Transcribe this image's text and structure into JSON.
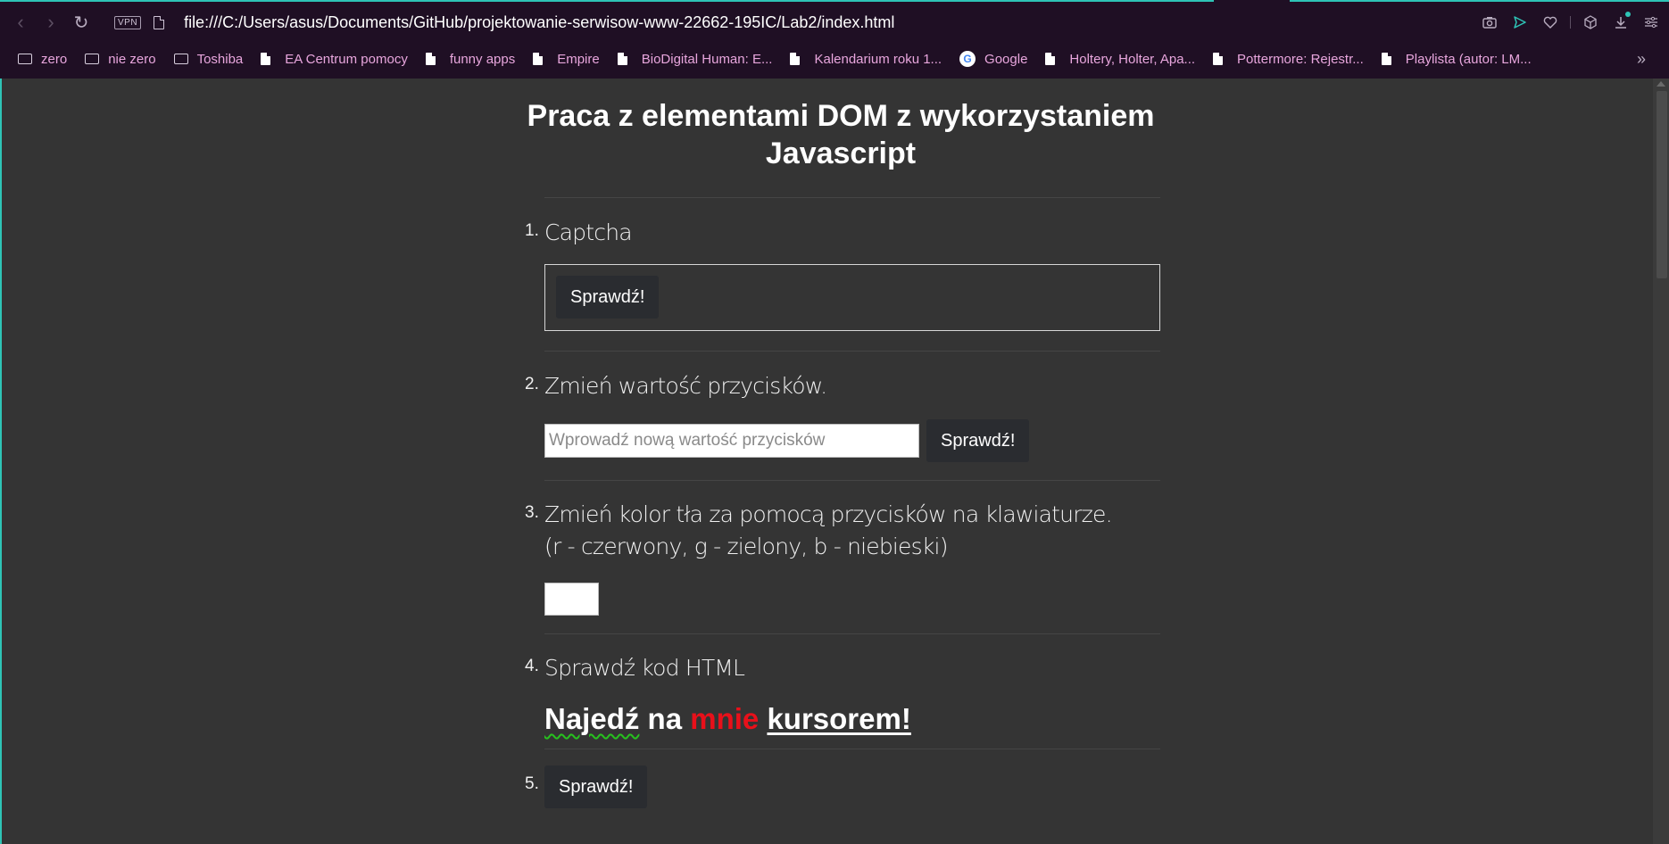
{
  "browser": {
    "url": "file:///C:/Users/asus/Documents/GitHub/projektowanie-serwisow-www-22662-195IC/Lab2/index.html",
    "vpn_label": "VPN",
    "bookmarks": [
      {
        "label": "zero",
        "icon": "folder-icon"
      },
      {
        "label": "nie zero",
        "icon": "folder-icon"
      },
      {
        "label": "Toshiba",
        "icon": "folder-icon"
      },
      {
        "label": "EA Centrum pomocy",
        "icon": "page-icon"
      },
      {
        "label": "funny apps",
        "icon": "page-icon"
      },
      {
        "label": "Empire",
        "icon": "page-icon"
      },
      {
        "label": "BioDigital Human: E...",
        "icon": "page-icon"
      },
      {
        "label": "Kalendarium roku 1...",
        "icon": "page-icon"
      },
      {
        "label": "Google",
        "icon": "google-icon"
      },
      {
        "label": "Holtery, Holter, Apa...",
        "icon": "page-icon"
      },
      {
        "label": "Pottermore: Rejestr...",
        "icon": "page-icon"
      },
      {
        "label": "Playlista (autor: LM...",
        "icon": "page-icon"
      }
    ],
    "accent_color": "#2ec4b6",
    "bookmark_color": "#e8a6dd"
  },
  "page": {
    "title": "Praca z elementami DOM z wykorzystaniem Javascript",
    "sections": {
      "s1": {
        "num": "1.",
        "title": "Captcha",
        "button": "Sprawdź!"
      },
      "s2": {
        "num": "2.",
        "title": "Zmień wartość przycisków.",
        "placeholder": "Wprowadź nową wartość przycisków",
        "button": "Sprawdź!"
      },
      "s3": {
        "num": "3.",
        "title": "Zmień kolor tła za pomocą przycisków na klawiaturze.",
        "subtitle": "(r - czerwony, g - zielony, b - niebieski)"
      },
      "s4": {
        "num": "4.",
        "title": "Sprawdź kod HTML",
        "hover_words": [
          "Najedź",
          "na",
          "mnie",
          "kursorem!"
        ]
      },
      "s5": {
        "num": "5.",
        "button": "Sprawdź!"
      }
    }
  }
}
